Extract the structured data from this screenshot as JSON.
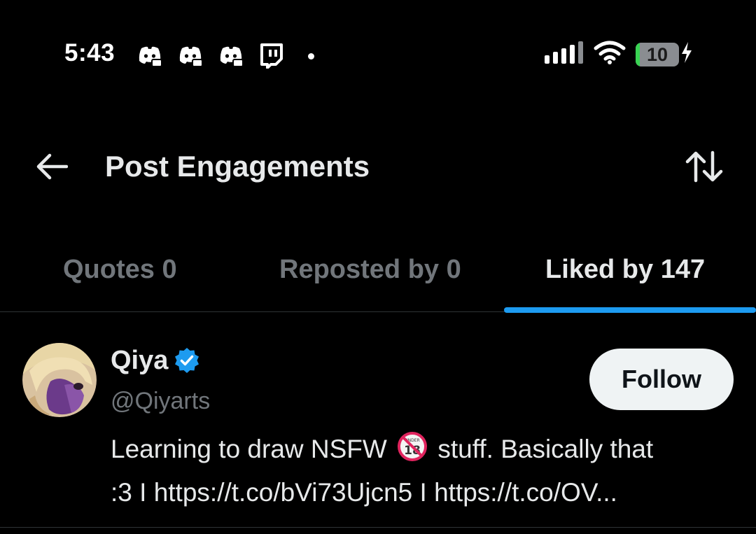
{
  "status_bar": {
    "time": "5:43",
    "notification_icons": [
      "discord-icon",
      "discord-icon",
      "discord-icon",
      "twitch-icon"
    ],
    "battery_level": 10,
    "battery_text": "10",
    "charging": true
  },
  "header": {
    "title": "Post Engagements",
    "back_icon": "arrow-left-icon",
    "sort_icon": "sort-arrows-icon"
  },
  "tabs": [
    {
      "label": "Quotes 0",
      "active": false
    },
    {
      "label": "Reposted by 0",
      "active": false
    },
    {
      "label": "Liked by 147",
      "active": true
    }
  ],
  "colors": {
    "accent": "#1d9bf0",
    "background": "#000000",
    "secondary_text": "#71767b",
    "primary_text": "#e7e9ea",
    "battery_fill": "#39d353"
  },
  "users": [
    {
      "display_name": "Qiya",
      "verified": true,
      "handle": "@Qiyarts",
      "follow_label": "Follow",
      "bio_line1_before": "Learning to draw NSFW",
      "bio_emoji": "no-one-under-18-icon",
      "bio_line1_after": "stuff. Basically that",
      "bio_line2": ":3 I https://t.co/bVi73Ujcn5 I https://t.co/OV..."
    }
  ]
}
